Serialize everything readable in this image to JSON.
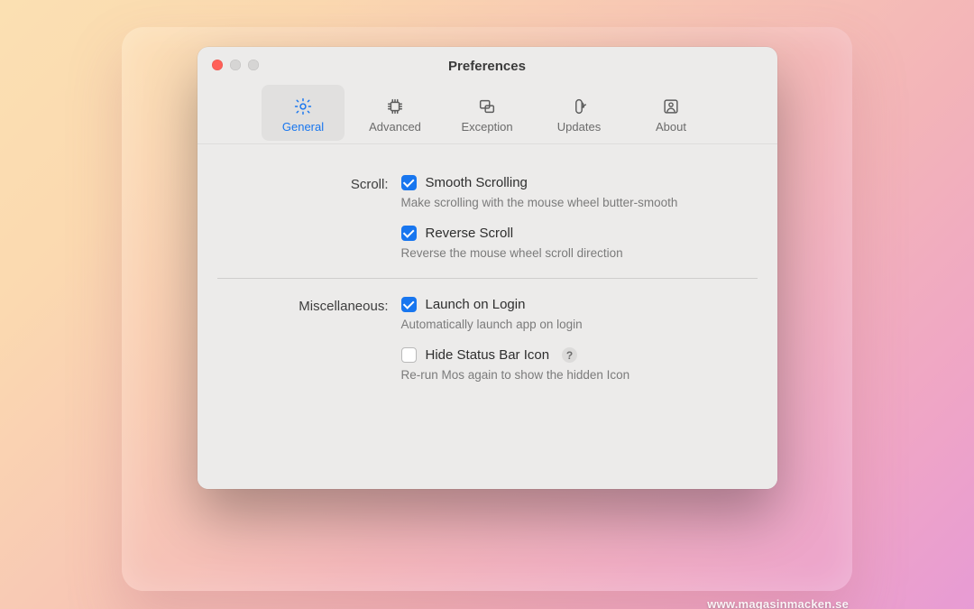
{
  "window": {
    "title": "Preferences"
  },
  "tabs": {
    "general": {
      "label": "General"
    },
    "advanced": {
      "label": "Advanced"
    },
    "exception": {
      "label": "Exception"
    },
    "updates": {
      "label": "Updates"
    },
    "about": {
      "label": "About"
    }
  },
  "sections": {
    "scroll": {
      "label": "Scroll:",
      "smooth": {
        "title": "Smooth Scrolling",
        "desc": "Make scrolling with the mouse wheel butter-smooth",
        "checked": true
      },
      "reverse": {
        "title": "Reverse Scroll",
        "desc": "Reverse the mouse wheel scroll direction",
        "checked": true
      }
    },
    "misc": {
      "label": "Miscellaneous:",
      "launch": {
        "title": "Launch on Login",
        "desc": "Automatically launch app on login",
        "checked": true
      },
      "hide": {
        "title": "Hide Status Bar Icon",
        "desc": "Re-run Mos again to show the hidden Icon",
        "checked": false,
        "help": "?"
      }
    }
  },
  "watermark": "www.magasinmacken.se"
}
